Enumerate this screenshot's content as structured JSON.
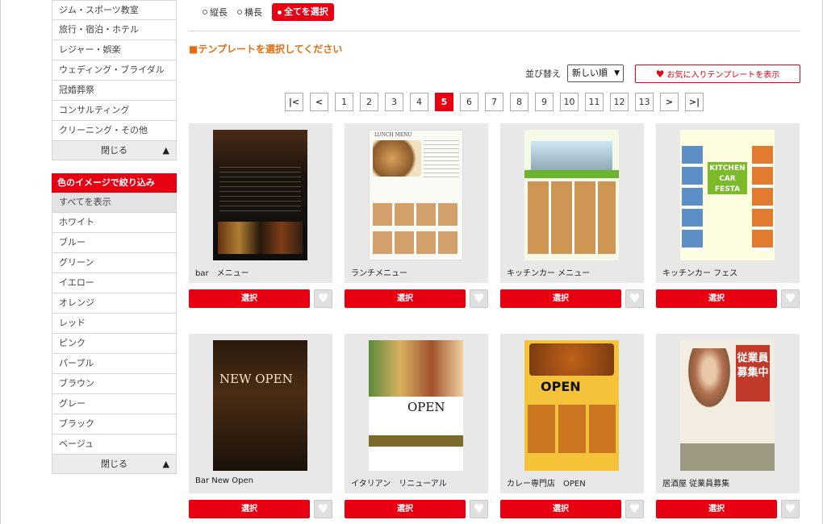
{
  "sidebar": {
    "category_items": [
      "ジム・スポーツ教室",
      "旅行・宿泊・ホテル",
      "レジャー・娯楽",
      "ウェディング・ブライダル",
      "冠婚葬祭",
      "コンサルティング",
      "クリーニング・その他"
    ],
    "close_label": "閉じる",
    "color_heading": "色のイメージで絞り込み",
    "color_items": [
      "すべてを表示",
      "ホワイト",
      "ブルー",
      "グリーン",
      "イエロー",
      "オレンジ",
      "レッド",
      "ピンク",
      "パープル",
      "ブラウン",
      "グレー",
      "ブラック",
      "ベージュ"
    ],
    "color_selected": "すべてを表示",
    "close_label_2": "閉じる"
  },
  "filter": {
    "vertical": "縦長",
    "horizontal": "横長",
    "all": "全てを選択"
  },
  "section_title": "■テンプレートを選択してください",
  "sort": {
    "label": "並び替え",
    "value": "新しい順"
  },
  "favorite_button": "お気に入りテンプレートを表示",
  "pagination": {
    "first": "|<",
    "prev": "<",
    "pages": [
      "1",
      "2",
      "3",
      "4",
      "5",
      "6",
      "7",
      "8",
      "9",
      "10",
      "11",
      "12",
      "13"
    ],
    "current": "5",
    "next": ">",
    "last": ">|"
  },
  "cards": [
    {
      "name": "bar　メニュー",
      "select": "選択"
    },
    {
      "name": "ランチメニュー",
      "select": "選択"
    },
    {
      "name": "キッチンカー メニュー",
      "select": "選択"
    },
    {
      "name": "キッチンカー フェス",
      "select": "選択"
    },
    {
      "name": "Bar New Open",
      "select": "選択"
    },
    {
      "name": "イタリアン　リニューアル",
      "select": "選択"
    },
    {
      "name": "カレー専門店　OPEN",
      "select": "選択"
    },
    {
      "name": "居酒屋 従業員募集",
      "select": "選択"
    }
  ],
  "thumb_text": {
    "lunch": "LUNCH MENU",
    "kitchen": "KITCHEN CAR FESTA",
    "newopen": "NEW OPEN",
    "open": "OPEN",
    "jobs": "従業員募集中"
  },
  "colors": {
    "accent": "#e60012",
    "title_orange": "#e96b0a"
  }
}
